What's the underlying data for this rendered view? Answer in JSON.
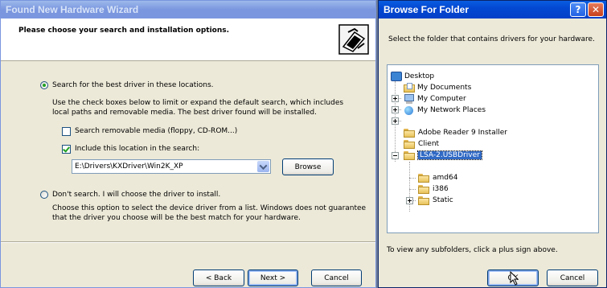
{
  "wizard": {
    "title": "Found New Hardware Wizard",
    "header_title": "Please choose your search and installation options.",
    "option_search": {
      "label": "Search for the best driver in these locations.",
      "checked": true,
      "description": "Use the check boxes below to limit or expand the default search, which includes local paths and removable media. The best driver found will be installed."
    },
    "check_removable": {
      "label": "Search removable media (floppy, CD-ROM...)",
      "checked": false
    },
    "check_location": {
      "label": "Include this location in the search:",
      "checked": true
    },
    "location_path": "E:\\Drivers\\KXDriver\\Win2K_XP",
    "browse_label": "Browse",
    "option_dont_search": {
      "label": "Don't search. I will choose the driver to install.",
      "checked": false,
      "description": "Choose this option to select the device driver from a list.  Windows does not guarantee that the driver you choose will be the best match for your hardware."
    },
    "back_label": "< Back",
    "next_label": "Next >",
    "cancel_label": "Cancel"
  },
  "browse_dialog": {
    "title": "Browse For Folder",
    "help_glyph": "?",
    "close_glyph": "✕",
    "instruction": "Select the folder that contains drivers for your hardware.",
    "tree": [
      {
        "label": "Desktop",
        "icon": "desktop-icon",
        "expander": "none"
      },
      {
        "label": "My Documents",
        "icon": "my-documents-icon",
        "expander": "plus"
      },
      {
        "label": "My Computer",
        "icon": "my-computer-icon",
        "expander": "plus"
      },
      {
        "label": "My Network Places",
        "icon": "network-places-icon",
        "expander": "plus"
      },
      {
        "label": "Adobe Reader 9 Installer",
        "icon": "folder-icon",
        "expander": "none"
      },
      {
        "label": "Client",
        "icon": "folder-icon",
        "expander": "none"
      },
      {
        "label": "LSA-2.USBDriver",
        "icon": "folder-icon",
        "expander": "minus",
        "selected": true
      },
      {
        "label": "amd64",
        "icon": "folder-icon",
        "expander": "none"
      },
      {
        "label": "i386",
        "icon": "folder-icon",
        "expander": "none"
      },
      {
        "label": "Static",
        "icon": "folder-icon",
        "expander": "plus"
      }
    ],
    "hint": "To view any subfolders, click a plus sign above.",
    "ok_label": "OK",
    "cancel_label": "Cancel"
  }
}
